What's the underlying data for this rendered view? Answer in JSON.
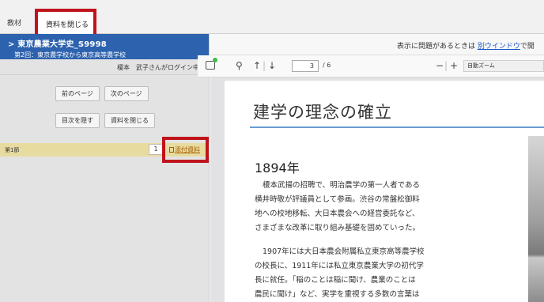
{
  "tabs": {
    "kyozai": "教材",
    "close_material": "資料を閉じる"
  },
  "sidebar": {
    "course_title": "> 東京農業大学史_S9998",
    "course_subtitle": "第2回：東京農学校から東京高等農学校",
    "login_text": "榎本　武子さんがログイン中",
    "buttons": {
      "prev_page": "前のページ",
      "next_page": "次のページ",
      "hide_toc": "目次を隠す",
      "close_material": "資料を閉じる"
    },
    "section": {
      "label": "第1節",
      "page": "1",
      "attachment": "添付資料"
    }
  },
  "notice": {
    "text": "表示に問題があるときは",
    "link": "別ウインドウ",
    "tail": "で開"
  },
  "pdf_toolbar": {
    "page_current": "3",
    "page_total": "/ 6",
    "zoom": "自動ズーム"
  },
  "document": {
    "heading": "建学の理念の確立",
    "year": "1894年",
    "para1": [
      "榎本武揚の招聘で、明治農学の第一人者である",
      "横井時敬が評議員として参画。渋谷の常盤松御料",
      "地への校地移転、大日本農会への経営委託など、",
      "さまざまな改革に取り組み基礎を固めていった。"
    ],
    "para2": [
      "1907年には大日本農会附属私立東京高等農学校",
      "の校長に、1911年には私立東京農業大学の初代学",
      "長に就任。「稲のことは稲に聞け、農業のことは",
      "農民に聞け」など、実学を重視する多数の言葉は"
    ]
  }
}
